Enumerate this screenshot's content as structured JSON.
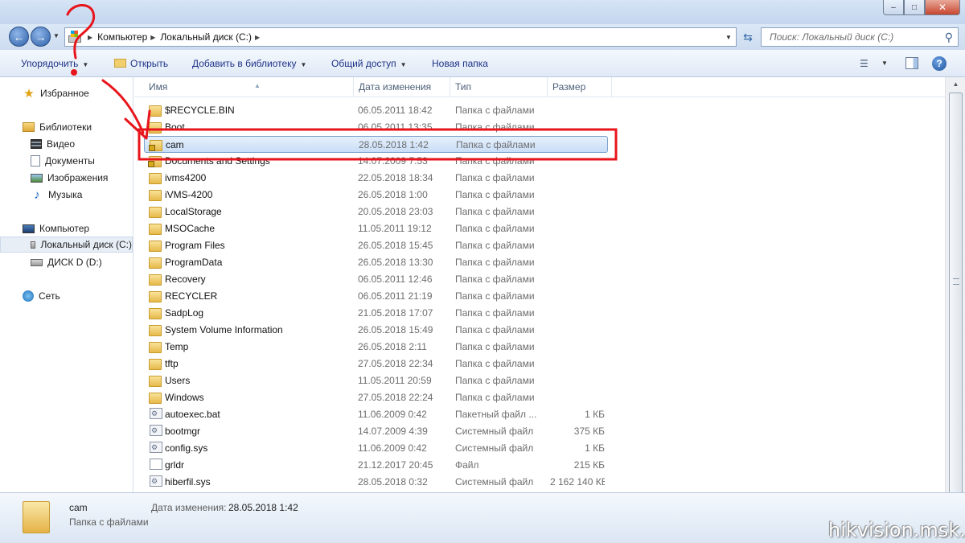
{
  "window": {
    "minimize": "–",
    "maximize": "□",
    "close": "✕"
  },
  "address": {
    "crumbs": [
      "Компьютер",
      "Локальный диск (C:)"
    ],
    "search_placeholder": "Поиск: Локальный диск (C:)",
    "icons": [
      "back-arrow-icon",
      "forward-arrow-icon",
      "drive-icon",
      "refresh-icon",
      "search-icon"
    ]
  },
  "toolbar": {
    "organize": "Упорядочить",
    "open": "Открыть",
    "add_to_library": "Добавить в библиотеку",
    "share": "Общий доступ",
    "new_folder": "Новая папка",
    "icons": [
      "view-icon",
      "preview-pane-icon",
      "help-icon"
    ]
  },
  "navigation": {
    "favorites": "Избранное",
    "libraries": "Библиотеки",
    "video": "Видео",
    "documents": "Документы",
    "images": "Изображения",
    "music": "Музыка",
    "computer": "Компьютер",
    "local_disk": "Локальный диск (C:)",
    "disk_d": "ДИСК D (D:)",
    "network": "Сеть"
  },
  "columns": {
    "name": "Имя",
    "date": "Дата изменения",
    "type": "Тип",
    "size": "Размер"
  },
  "files": [
    {
      "name": "$RECYCLE.BIN",
      "date": "06.05.2011 18:42",
      "type": "Папка с файлами",
      "size": "",
      "kind": "folder"
    },
    {
      "name": "Boot",
      "date": "06.05.2011 13:35",
      "type": "Папка с файлами",
      "size": "",
      "kind": "folder"
    },
    {
      "name": "cam",
      "date": "28.05.2018 1:42",
      "type": "Папка с файлами",
      "size": "",
      "kind": "folder-lock",
      "selected": true
    },
    {
      "name": "Documents and Settings",
      "date": "14.07.2009 7:53",
      "type": "Папка с файлами",
      "size": "",
      "kind": "folder-lock"
    },
    {
      "name": "ivms4200",
      "date": "22.05.2018 18:34",
      "type": "Папка с файлами",
      "size": "",
      "kind": "folder"
    },
    {
      "name": "iVMS-4200",
      "date": "26.05.2018 1:00",
      "type": "Папка с файлами",
      "size": "",
      "kind": "folder"
    },
    {
      "name": "LocalStorage",
      "date": "20.05.2018 23:03",
      "type": "Папка с файлами",
      "size": "",
      "kind": "folder"
    },
    {
      "name": "MSOCache",
      "date": "11.05.2011 19:12",
      "type": "Папка с файлами",
      "size": "",
      "kind": "folder"
    },
    {
      "name": "Program Files",
      "date": "26.05.2018 15:45",
      "type": "Папка с файлами",
      "size": "",
      "kind": "folder"
    },
    {
      "name": "ProgramData",
      "date": "26.05.2018 13:30",
      "type": "Папка с файлами",
      "size": "",
      "kind": "folder"
    },
    {
      "name": "Recovery",
      "date": "06.05.2011 12:46",
      "type": "Папка с файлами",
      "size": "",
      "kind": "folder"
    },
    {
      "name": "RECYCLER",
      "date": "06.05.2011 21:19",
      "type": "Папка с файлами",
      "size": "",
      "kind": "folder"
    },
    {
      "name": "SadpLog",
      "date": "21.05.2018 17:07",
      "type": "Папка с файлами",
      "size": "",
      "kind": "folder"
    },
    {
      "name": "System Volume Information",
      "date": "26.05.2018 15:49",
      "type": "Папка с файлами",
      "size": "",
      "kind": "folder"
    },
    {
      "name": "Temp",
      "date": "26.05.2018 2:11",
      "type": "Папка с файлами",
      "size": "",
      "kind": "folder"
    },
    {
      "name": "tftp",
      "date": "27.05.2018 22:34",
      "type": "Папка с файлами",
      "size": "",
      "kind": "folder"
    },
    {
      "name": "Users",
      "date": "11.05.2011 20:59",
      "type": "Папка с файлами",
      "size": "",
      "kind": "folder"
    },
    {
      "name": "Windows",
      "date": "27.05.2018 22:24",
      "type": "Папка с файлами",
      "size": "",
      "kind": "folder"
    },
    {
      "name": "autoexec.bat",
      "date": "11.06.2009 0:42",
      "type": "Пакетный файл ...",
      "size": "1 КБ",
      "kind": "gear"
    },
    {
      "name": "bootmgr",
      "date": "14.07.2009 4:39",
      "type": "Системный файл",
      "size": "375 КБ",
      "kind": "gear"
    },
    {
      "name": "config.sys",
      "date": "11.06.2009 0:42",
      "type": "Системный файл",
      "size": "1 КБ",
      "kind": "gear"
    },
    {
      "name": "grldr",
      "date": "21.12.2017 20:45",
      "type": "Файл",
      "size": "215 КБ",
      "kind": "doc"
    },
    {
      "name": "hiberfil.sys",
      "date": "28.05.2018 0:32",
      "type": "Системный файл",
      "size": "2 162 140 КБ",
      "kind": "gear"
    }
  ],
  "details": {
    "name": "cam",
    "type": "Папка с файлами",
    "date_label": "Дата изменения:",
    "date_value": "28.05.2018 1:42"
  },
  "watermark": "hikvision.msk.ru",
  "annotation": {
    "color": "#e8141b",
    "question_mark": "?"
  }
}
